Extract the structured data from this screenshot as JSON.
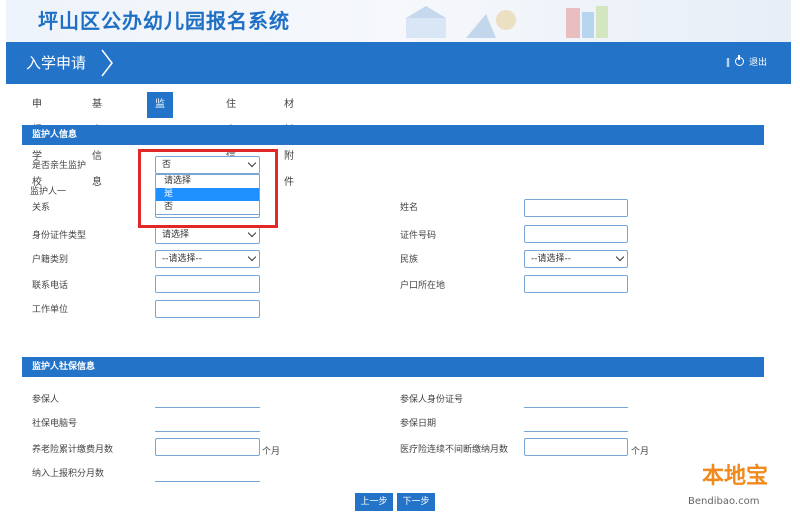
{
  "site": {
    "title": "坪山区公办幼儿园报名系统"
  },
  "nav": {
    "current": "入学申请",
    "user_action": "退出"
  },
  "tabs": [
    "申报学校",
    "基本信息",
    "监护人信息",
    "住房信息",
    "材料附件"
  ],
  "section_guardian": {
    "header": "监护人信息",
    "is_primary_guardian_label": "是否亲生监护",
    "is_primary_guardian_value": "否",
    "dropdown_options": [
      "请选择",
      "是",
      "否"
    ],
    "dropdown_highlighted": "是",
    "guardian_one_label": "监护人一",
    "relation_label": "关系",
    "name_label": "姓名",
    "id_type_label": "身份证件类型",
    "id_type_value": "请选择",
    "id_number_label": "证件号码",
    "household_label": "户籍类别",
    "household_value": "--请选择--",
    "ethnicity_label": "民族",
    "ethnicity_value": "--请选择--",
    "phone_label": "联系电话",
    "hukou_location_label": "户口所在地",
    "employer_label": "工作单位"
  },
  "section_social": {
    "header": "监护人社保信息",
    "insured_label": "参保人",
    "insured_id_label": "参保人身份证号",
    "social_no_label": "社保电脑号",
    "insured_date_label": "参保日期",
    "pension_months_label": "养老险累计缴费月数",
    "medical_months_label": "医疗险连续不间断缴纳月数",
    "unit_months": "个月",
    "settle_months_label": "纳入上报积分月数"
  },
  "buttons": {
    "prev": "上一步",
    "next": "下一步"
  },
  "watermark": {
    "brand": "本地宝",
    "url": "Bendibao.com"
  },
  "colors": {
    "primary": "#2373c8",
    "highlight": "#e02828",
    "brand": "#f08a1c"
  }
}
